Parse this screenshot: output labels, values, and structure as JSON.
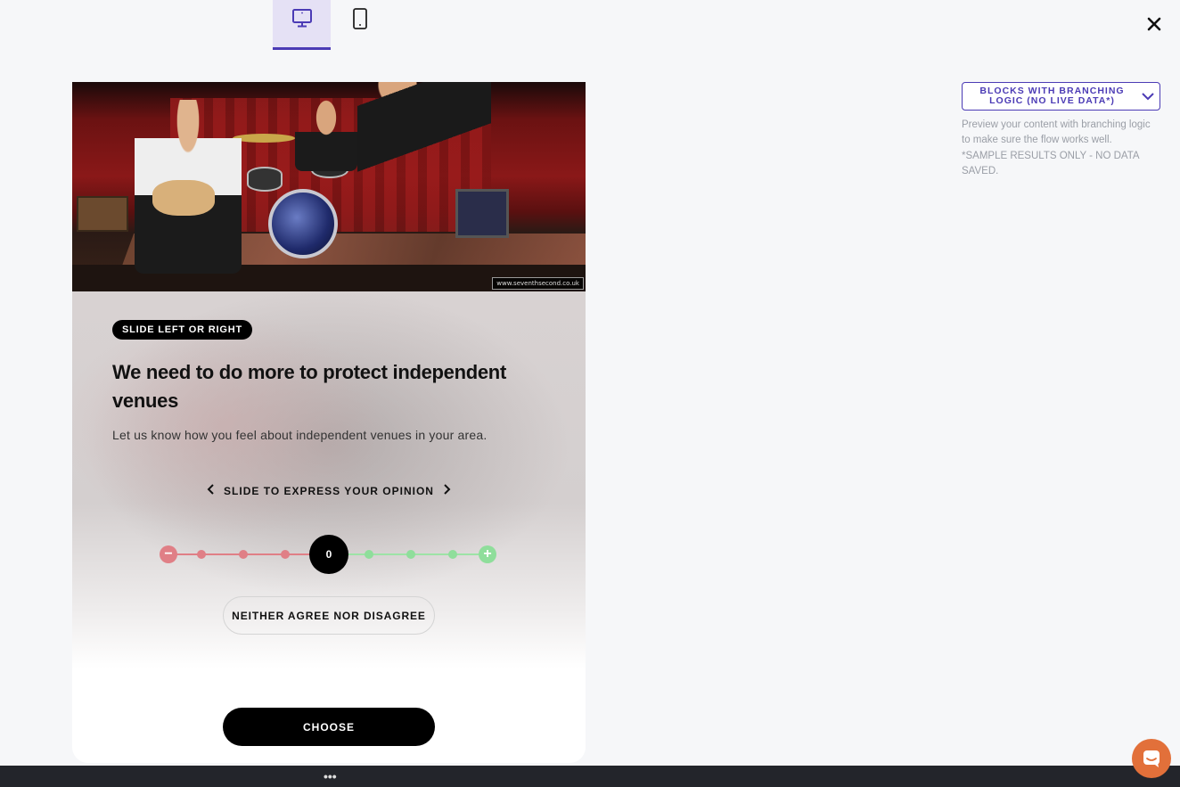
{
  "toolbar": {
    "devices": [
      {
        "name": "desktop",
        "icon": "desktop-icon",
        "active": true
      },
      {
        "name": "mobile",
        "icon": "mobile-icon",
        "active": false
      }
    ],
    "close_icon": "close-icon"
  },
  "preview": {
    "image_credit": "www.seventhsecond.co.uk",
    "badge": "SLIDE LEFT OR RIGHT",
    "question": "We need to do more to protect independent venues",
    "description": "Let us know how you feel about independent venues in your area.",
    "slide_hint": "SLIDE TO EXPRESS YOUR OPINION",
    "slider": {
      "value": "0",
      "min_label": "−",
      "max_label": "+",
      "negative_color": "#e07f86",
      "positive_color": "#8fde9b"
    },
    "neutral_label": "NEITHER AGREE NOR DISAGREE",
    "choose_label": "CHOOSE"
  },
  "sidebar": {
    "mode_label": "BLOCKS WITH BRANCHING LOGIC (NO LIVE DATA*)",
    "mode_description": "Preview your content with branching logic to make sure the flow works well.",
    "mode_note": "*SAMPLE RESULTS ONLY - NO DATA SAVED.",
    "accent_color": "#4b3bb5"
  },
  "footer": {
    "more_label": "•••"
  },
  "chat": {
    "icon": "chat-icon",
    "color": "#e2703a"
  }
}
